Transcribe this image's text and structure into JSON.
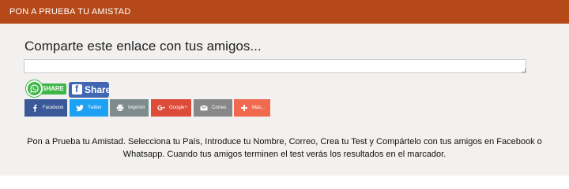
{
  "header": {
    "title": "PON A PRUEBA TU AMISTAD"
  },
  "share": {
    "title": "Comparte este enlace con tus amigos...",
    "link_value": "",
    "whatsapp_label": "SHARE",
    "facebook_label": "Share"
  },
  "social_buttons": [
    {
      "label": "Facebook",
      "icon": "facebook-icon",
      "color": "#3b5998"
    },
    {
      "label": "Twitter",
      "icon": "twitter-icon",
      "color": "#1da1f2"
    },
    {
      "label": "Imprimir",
      "icon": "printer-icon",
      "color": "#7f8c8d"
    },
    {
      "label": "Google+",
      "icon": "google-plus-icon",
      "color": "#dd4b39"
    },
    {
      "label": "Correo",
      "icon": "mail-icon",
      "color": "#888888"
    },
    {
      "label": "Más...",
      "icon": "plus-icon",
      "color": "#f1694f"
    }
  ],
  "description": "Pon a Prueba tu Amistad. Selecciona tu País, Introduce tu Nombre, Correo, Crea tu Test y Compártelo con tus amigos en Facebook o Whatsapp. Cuando tus amigos terminen el test verás los resultados en el marcador.",
  "colors": {
    "header": "#b54918",
    "panel": "#f3f1ef",
    "whatsapp": "#3fb64a",
    "facebook": "#4267b2"
  }
}
